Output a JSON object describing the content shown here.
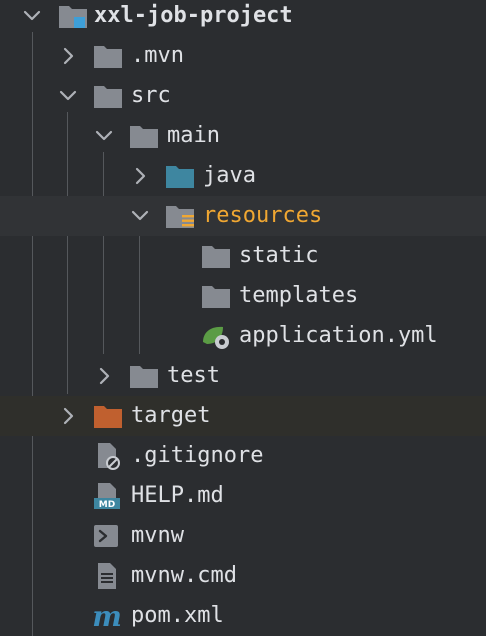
{
  "tree": {
    "root": {
      "label": "xxl-job-project",
      "icon": "module-folder-icon",
      "expanded": true
    },
    "mvn": {
      "label": ".mvn",
      "icon": "folder-icon",
      "expanded": false
    },
    "src": {
      "label": "src",
      "icon": "folder-icon",
      "expanded": true
    },
    "main": {
      "label": "main",
      "icon": "folder-icon",
      "expanded": true
    },
    "java": {
      "label": "java",
      "icon": "source-root-folder-icon",
      "expanded": false
    },
    "resources": {
      "label": "resources",
      "icon": "resources-root-folder-icon",
      "expanded": true,
      "color": "#f0a732"
    },
    "static": {
      "label": "static",
      "icon": "folder-icon"
    },
    "templates": {
      "label": "templates",
      "icon": "folder-icon"
    },
    "application_yml": {
      "label": "application.yml",
      "icon": "spring-config-icon"
    },
    "test": {
      "label": "test",
      "icon": "folder-icon",
      "expanded": false
    },
    "target": {
      "label": "target",
      "icon": "excluded-folder-icon",
      "expanded": false,
      "color": "#c0602f"
    },
    "gitignore": {
      "label": ".gitignore",
      "icon": "ignored-file-icon"
    },
    "help_md": {
      "label": "HELP.md",
      "icon": "markdown-file-icon",
      "badge": "MD"
    },
    "mvnw": {
      "label": "mvnw",
      "icon": "shell-script-icon"
    },
    "mvnw_cmd": {
      "label": "mvnw.cmd",
      "icon": "text-file-icon"
    },
    "pom_xml": {
      "label": "pom.xml",
      "icon": "maven-icon",
      "glyph": "m"
    }
  },
  "colors": {
    "background": "#2b2d30",
    "text": "#dfe1e5",
    "folder": "#868a91",
    "source_folder": "#3e86a0",
    "resources_label": "#f0a732",
    "excluded_folder": "#c0602f",
    "maven_blue": "#3c8dbc"
  }
}
